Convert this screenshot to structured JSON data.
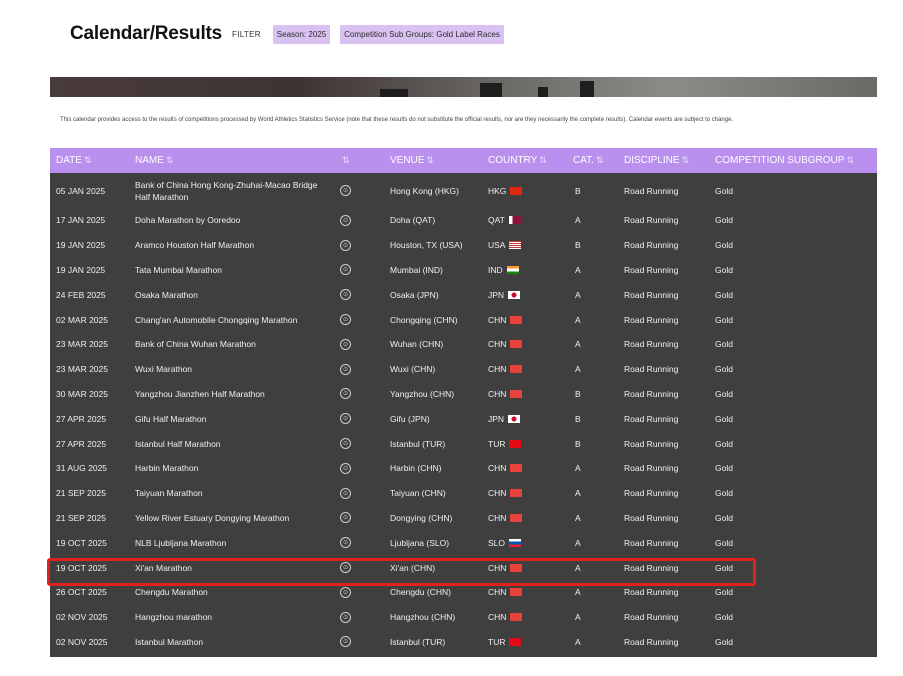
{
  "page": {
    "title": "Calendar/Results",
    "filter_label": "FILTER",
    "chips": [
      "Season: 2025",
      "Competition Sub Groups: Gold Label Races"
    ],
    "intro": "This calendar provides access to the results of competitions processed by World Athletics Statistics Service (note that these results do not substitute the official results, nor are they necessarily the complete results). Calendar events are subject to change."
  },
  "colors": {
    "header_bg": "#ba90ef",
    "table_bg": "#3f3f3f",
    "chip_bg": "#d9c2f2",
    "highlight": "#e0211c"
  },
  "table": {
    "columns": [
      {
        "label": "DATE",
        "sort_icon": "⇅"
      },
      {
        "label": "NAME",
        "sort_icon": "⇅"
      },
      {
        "label": "",
        "sort_icon": "⇅"
      },
      {
        "label": "VENUE",
        "sort_icon": "⇅"
      },
      {
        "label": "COUNTRY",
        "sort_icon": "⇅"
      },
      {
        "label": "CAT.",
        "sort_icon": "⇅"
      },
      {
        "label": "DISCIPLINE",
        "sort_icon": "⇅"
      },
      {
        "label": "COMPETITION SUBGROUP",
        "sort_icon": "⇅"
      }
    ],
    "rows": [
      {
        "date": "05 JAN 2025",
        "name": "Bank of China Hong Kong-Zhuhai-Macao Bridge Half Marathon",
        "venue": "Hong Kong (HKG)",
        "country": "HKG",
        "flag": "hkg",
        "cat": "B",
        "discipline": "Road Running",
        "subgroup": "Gold"
      },
      {
        "date": "17 JAN 2025",
        "name": "Doha Marathon by Ooredoo",
        "venue": "Doha (QAT)",
        "country": "QAT",
        "flag": "qat",
        "cat": "A",
        "discipline": "Road Running",
        "subgroup": "Gold"
      },
      {
        "date": "19 JAN 2025",
        "name": "Aramco Houston Half Marathon",
        "venue": "Houston, TX (USA)",
        "country": "USA",
        "flag": "usa",
        "cat": "B",
        "discipline": "Road Running",
        "subgroup": "Gold"
      },
      {
        "date": "19 JAN 2025",
        "name": "Tata Mumbai Marathon",
        "venue": "Mumbai (IND)",
        "country": "IND",
        "flag": "ind",
        "cat": "A",
        "discipline": "Road Running",
        "subgroup": "Gold"
      },
      {
        "date": "24 FEB 2025",
        "name": "Osaka Marathon",
        "venue": "Osaka (JPN)",
        "country": "JPN",
        "flag": "jpn",
        "cat": "A",
        "discipline": "Road Running",
        "subgroup": "Gold"
      },
      {
        "date": "02 MAR 2025",
        "name": "Chang'an Automobile Chongqing Marathon",
        "venue": "Chongqing (CHN)",
        "country": "CHN",
        "flag": "chn",
        "cat": "A",
        "discipline": "Road Running",
        "subgroup": "Gold"
      },
      {
        "date": "23 MAR 2025",
        "name": "Bank of China Wuhan Marathon",
        "venue": "Wuhan (CHN)",
        "country": "CHN",
        "flag": "chn",
        "cat": "A",
        "discipline": "Road Running",
        "subgroup": "Gold"
      },
      {
        "date": "23 MAR 2025",
        "name": "Wuxi Marathon",
        "venue": "Wuxi (CHN)",
        "country": "CHN",
        "flag": "chn",
        "cat": "A",
        "discipline": "Road Running",
        "subgroup": "Gold"
      },
      {
        "date": "30 MAR 2025",
        "name": "Yangzhou Jianzhen Half Marathon",
        "venue": "Yangzhou (CHN)",
        "country": "CHN",
        "flag": "chn",
        "cat": "B",
        "discipline": "Road Running",
        "subgroup": "Gold"
      },
      {
        "date": "27 APR 2025",
        "name": "Gifu Half Marathon",
        "venue": "Gifu (JPN)",
        "country": "JPN",
        "flag": "jpn",
        "cat": "B",
        "discipline": "Road Running",
        "subgroup": "Gold"
      },
      {
        "date": "27 APR 2025",
        "name": "Istanbul Half Marathon",
        "venue": "Istanbul (TUR)",
        "country": "TUR",
        "flag": "tur",
        "cat": "B",
        "discipline": "Road Running",
        "subgroup": "Gold"
      },
      {
        "date": "31 AUG 2025",
        "name": "Harbin Marathon",
        "venue": "Harbin (CHN)",
        "country": "CHN",
        "flag": "chn",
        "cat": "A",
        "discipline": "Road Running",
        "subgroup": "Gold"
      },
      {
        "date": "21 SEP 2025",
        "name": "Taiyuan Marathon",
        "venue": "Taiyuan (CHN)",
        "country": "CHN",
        "flag": "chn",
        "cat": "A",
        "discipline": "Road Running",
        "subgroup": "Gold"
      },
      {
        "date": "21 SEP 2025",
        "name": "Yellow River Estuary Dongying Marathon",
        "venue": "Dongying (CHN)",
        "country": "CHN",
        "flag": "chn",
        "cat": "A",
        "discipline": "Road Running",
        "subgroup": "Gold"
      },
      {
        "date": "19 OCT 2025",
        "name": "NLB Ljubljana Marathon",
        "venue": "Ljubljana (SLO)",
        "country": "SLO",
        "flag": "slo",
        "cat": "A",
        "discipline": "Road Running",
        "subgroup": "Gold"
      },
      {
        "date": "19 OCT 2025",
        "name": "Xi'an Marathon",
        "venue": "Xi'an (CHN)",
        "country": "CHN",
        "flag": "chn",
        "cat": "A",
        "discipline": "Road Running",
        "subgroup": "Gold"
      },
      {
        "date": "26 OCT 2025",
        "name": "Chengdu Marathon",
        "venue": "Chengdu (CHN)",
        "country": "CHN",
        "flag": "chn",
        "cat": "A",
        "discipline": "Road Running",
        "subgroup": "Gold"
      },
      {
        "date": "02 NOV 2025",
        "name": "Hangzhou marathon",
        "venue": "Hangzhou (CHN)",
        "country": "CHN",
        "flag": "chn",
        "cat": "A",
        "discipline": "Road Running",
        "subgroup": "Gold"
      },
      {
        "date": "02 NOV 2025",
        "name": "Istanbul Marathon",
        "venue": "Istanbul (TUR)",
        "country": "TUR",
        "flag": "tur",
        "cat": "A",
        "discipline": "Road Running",
        "subgroup": "Gold"
      }
    ]
  }
}
